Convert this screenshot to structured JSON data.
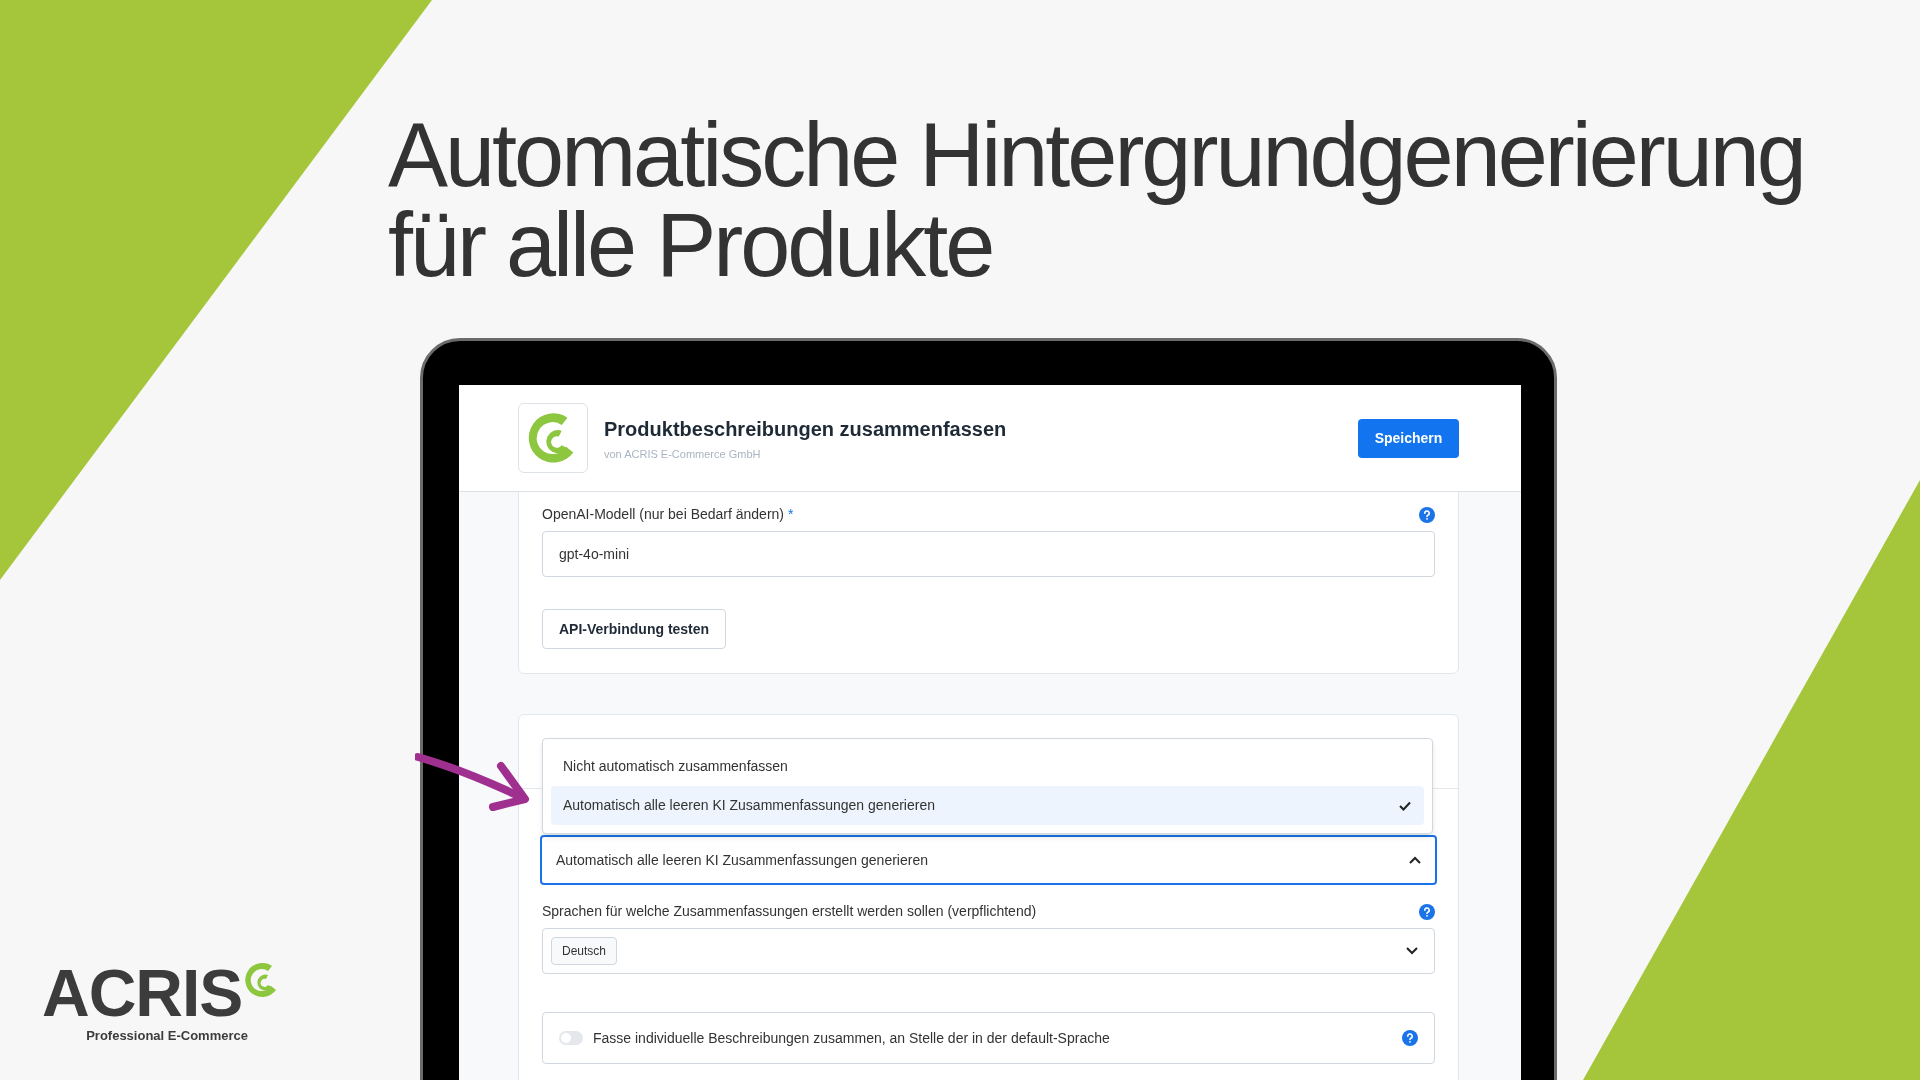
{
  "headline": [
    "Automatische Hintergrundgenerierung",
    "für alle Produkte"
  ],
  "app": {
    "title": "Produktbeschreibungen zusammenfassen",
    "vendor": "von ACRIS E-Commerce GmbH",
    "save_button": "Speichern"
  },
  "model_field": {
    "label": "OpenAI-Modell (nur bei Bedarf ändern)",
    "required_mark": "*",
    "value": "gpt-4o-mini"
  },
  "test_button": "API-Verbindung testen",
  "summary_mode": {
    "expanded": true,
    "value": "Automatisch alle leeren KI Zusammenfassungen generieren",
    "options": [
      {
        "label": "Nicht automatisch zusammenfassen",
        "selected": false
      },
      {
        "label": "Automatisch alle leeren KI Zusammenfassungen generieren",
        "selected": true
      }
    ]
  },
  "languages": {
    "label": "Sprachen für welche Zusammenfassungen erstellt werden sollen (verpflichtend)",
    "tags": [
      "Deutsch"
    ]
  },
  "toggle": {
    "label": "Fasse individuelle Beschreibungen zusammen, an Stelle der in der default-Sprache",
    "on": false
  },
  "brand": {
    "name": "ACRIS",
    "tagline": "Professional E-Commerce"
  }
}
